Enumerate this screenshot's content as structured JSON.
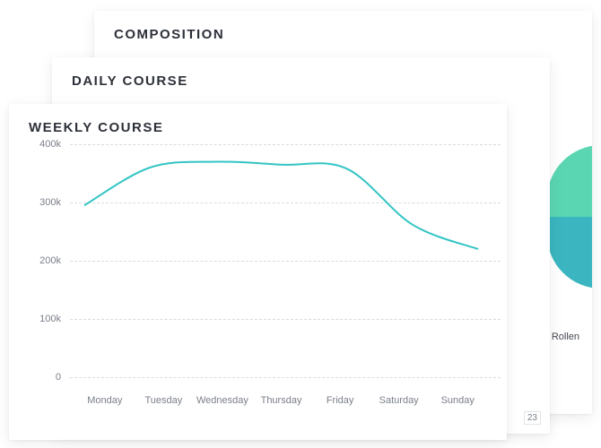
{
  "cards": {
    "back": {
      "title": "COMPOSITION",
      "legend_visible": "Rollen"
    },
    "mid": {
      "title": "DAILY COURSE",
      "fragment": "23"
    },
    "front": {
      "title": "WEEKLY COURSE"
    }
  },
  "chart_data": {
    "type": "line",
    "title": "WEEKLY COURSE",
    "xlabel": "",
    "ylabel": "",
    "categories": [
      "Monday",
      "Tuesday",
      "Wednesday",
      "Thursday",
      "Friday",
      "Saturday",
      "Sunday"
    ],
    "values": [
      295000,
      360000,
      370000,
      365000,
      358000,
      262000,
      220000
    ],
    "ylim": [
      0,
      400000
    ],
    "y_ticks": [
      0,
      100000,
      200000,
      300000,
      400000
    ],
    "y_tick_labels": [
      "0",
      "100k",
      "200k",
      "300k",
      "400k"
    ],
    "grid": true,
    "line_color": "#33c4c4"
  }
}
